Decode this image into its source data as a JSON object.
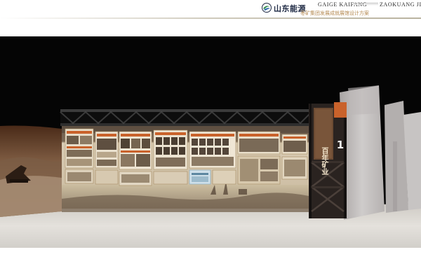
{
  "header": {
    "brand_name": "山东能源",
    "subtitle": "枣矿集团发展成就展馆设计方案",
    "latin_left": "GAIGE KAIFANG",
    "latin_right": "ZAOKUANG JI",
    "logo_icon": "shandong-energy-logo-icon"
  },
  "tower": {
    "number": "1",
    "title": "百年矿业"
  },
  "colors": {
    "brand_navy": "#1f2a44",
    "accent_orange": "#c9622b",
    "subtitle_gold": "#b58a52",
    "wall_beige": "#d8cbb3",
    "floor_grey": "#d9d6d1"
  }
}
